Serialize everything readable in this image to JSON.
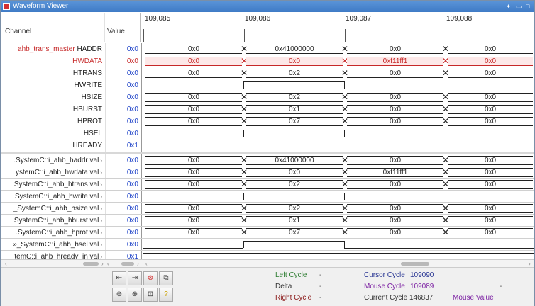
{
  "window": {
    "title": "Waveform Viewer"
  },
  "header": {
    "channel_label": "Channel",
    "value_label": "Value"
  },
  "timeline": {
    "ticks": [
      "109,085",
      "109,086",
      "109,087",
      "109,088"
    ]
  },
  "rows": [
    {
      "prefix": "ahb_trans_master",
      "name": "HADDR",
      "value": "0x0",
      "segments": [
        "0x0",
        "0x41000000",
        "0x0",
        "0x0"
      ]
    },
    {
      "name": "HWDATA",
      "value": "0x0",
      "segments": [
        "0x0",
        "0x0",
        "0xf11ff1",
        "0x0"
      ]
    },
    {
      "name": "HTRANS",
      "value": "0x0",
      "segments": [
        "0x0",
        "0x2",
        "0x0",
        "0x0"
      ]
    },
    {
      "name": "HWRITE",
      "value": "0x0"
    },
    {
      "name": "HSIZE",
      "value": "0x0",
      "segments": [
        "0x0",
        "0x2",
        "0x0",
        "0x0"
      ]
    },
    {
      "name": "HBURST",
      "value": "0x0",
      "segments": [
        "0x0",
        "0x1",
        "0x0",
        "0x0"
      ]
    },
    {
      "name": "HPROT",
      "value": "0x0",
      "segments": [
        "0x0",
        "0x7",
        "0x0",
        "0x0"
      ]
    },
    {
      "name": "HSEL",
      "value": "0x0"
    },
    {
      "name": "HREADY",
      "value": "0x1"
    },
    {
      "name": ".SystemC::i_ahb_haddr val",
      "value": "0x0",
      "segments": [
        "0x0",
        "0x41000000",
        "0x0",
        "0x0"
      ]
    },
    {
      "name": "ystemC::i_ahb_hwdata val",
      "value": "0x0",
      "segments": [
        "0x0",
        "0x0",
        "0xf11ff1",
        "0x0"
      ]
    },
    {
      "name": "SystemC::i_ahb_htrans val",
      "value": "0x0",
      "segments": [
        "0x0",
        "0x2",
        "0x0",
        "0x0"
      ]
    },
    {
      "name": "SystemC::i_ahb_hwrite val",
      "value": "0x0"
    },
    {
      "name": "_SystemC::i_ahb_hsize val",
      "value": "0x0",
      "segments": [
        "0x0",
        "0x2",
        "0x0",
        "0x0"
      ]
    },
    {
      "name": "SystemC::i_ahb_hburst val",
      "value": "0x0",
      "segments": [
        "0x0",
        "0x1",
        "0x0",
        "0x0"
      ]
    },
    {
      "name": ".SystemC::i_ahb_hprot val",
      "value": "0x0",
      "segments": [
        "0x0",
        "0x7",
        "0x0",
        "0x0"
      ]
    },
    {
      "name": "»_SystemC::i_ahb_hsel val",
      "value": "0x0"
    },
    {
      "name": "temC::i_ahb_hready_in val",
      "value": "0x1"
    }
  ],
  "status": {
    "left_cycle_label": "Left Cycle",
    "left_cycle_value": "-",
    "delta_label": "Delta",
    "delta_value": "-",
    "right_cycle_label": "Right Cycle",
    "right_cycle_value": "-",
    "cursor_cycle_label": "Cursor Cycle",
    "cursor_cycle_value": "109090",
    "mouse_cycle_label": "Mouse Cycle",
    "mouse_cycle_value": "109089",
    "mouse_cycle_dash": "-",
    "current_cycle_label": "Current Cycle",
    "current_cycle_value": "146837",
    "mouse_value_label": "Mouse Value"
  },
  "toolbar": {
    "icons": [
      "zoom-fit-left-icon",
      "zoom-fit-right-icon",
      "stop-icon",
      "zoom-window-icon",
      "zoom-out-icon",
      "zoom-in-icon",
      "zoom-area-icon",
      "help-icon"
    ]
  },
  "colors": {
    "accent": "#3f7bc6",
    "value_blue": "#1a3fc7",
    "highlight_red": "#c62828",
    "cycle_green": "#2e7d32",
    "cycle_purple": "#7b1fa2",
    "cycle_blue": "#283593",
    "cycle_darkred": "#8b1a1a"
  }
}
